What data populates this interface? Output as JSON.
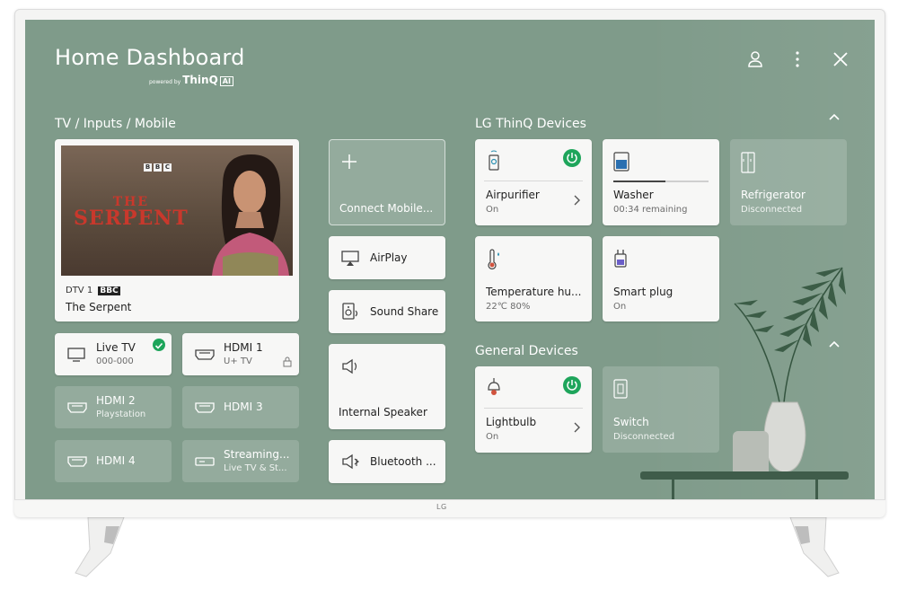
{
  "header": {
    "title": "Home Dashboard",
    "powered_by": "powered by",
    "brand": "ThinQ",
    "brand_badge": "AI"
  },
  "tv_brand": "LG",
  "sections": {
    "inputs": "TV / Inputs / Mobile",
    "thinq": "LG ThinQ Devices",
    "general": "General Devices"
  },
  "now_playing": {
    "channel": "DTV 1",
    "channel_logo": "BBC",
    "program": "The Serpent",
    "thumbnail_title_line1": "THE",
    "thumbnail_title_line2": "SERPENT"
  },
  "inputs": [
    {
      "name": "Live TV",
      "detail": "000-000",
      "selected": true,
      "active": true
    },
    {
      "name": "HDMI 1",
      "detail": "U+ TV",
      "active": true
    },
    {
      "name": "HDMI 2",
      "detail": "Playstation",
      "active": false
    },
    {
      "name": "HDMI 3",
      "detail": "",
      "active": false
    },
    {
      "name": "HDMI 4",
      "detail": "",
      "active": false
    },
    {
      "name": "Streaming...",
      "detail": "Live TV & St...",
      "active": false
    }
  ],
  "mobile": {
    "connect": "Connect Mobile...",
    "airplay": "AirPlay",
    "sound_share": "Sound Share",
    "internal_speaker": "Internal Speaker",
    "bluetooth": "Bluetooth ..."
  },
  "thinq_devices": [
    {
      "name": "Airpurifier",
      "status": "On",
      "power": true,
      "icon": "air-purifier-icon"
    },
    {
      "name": "Washer",
      "status": "00:34 remaining",
      "icon": "washer-icon",
      "progress": 0.55
    },
    {
      "name": "Refrigerator",
      "status": "Disconnected",
      "icon": "refrigerator-icon"
    },
    {
      "name": "Temperature hu...",
      "status": "22℃ 80%",
      "icon": "thermometer-icon"
    },
    {
      "name": "Smart plug",
      "status": "On",
      "icon": "plug-icon"
    }
  ],
  "general_devices": [
    {
      "name": "Lightbulb",
      "status": "On",
      "power": true,
      "icon": "lightbulb-icon"
    },
    {
      "name": "Switch",
      "status": "Disconnected",
      "icon": "switch-icon"
    }
  ],
  "colors": {
    "screen_bg": "#7f9b8a",
    "power_green": "#1ea55b",
    "card_bg": "#f7f7f6"
  }
}
